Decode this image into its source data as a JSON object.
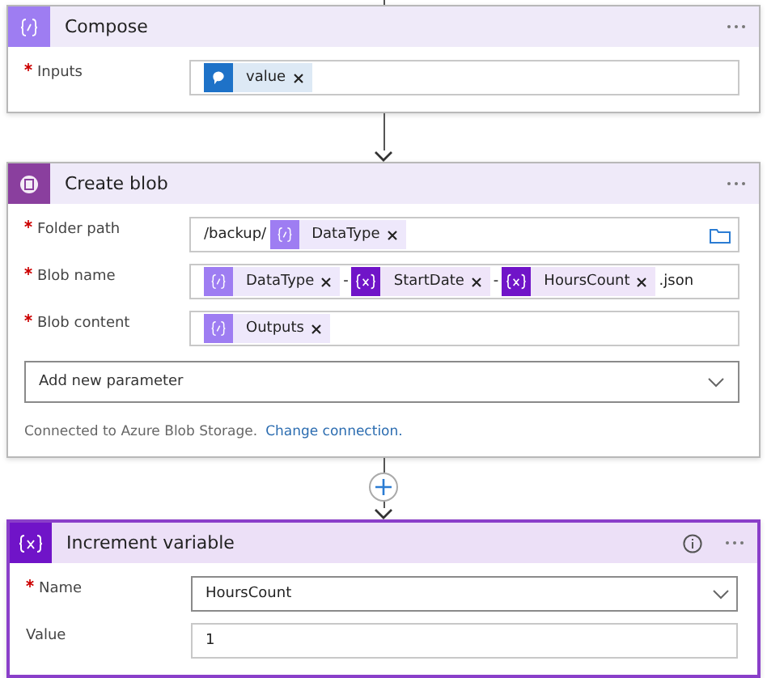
{
  "cards": [
    {
      "kind": "compose",
      "title": "Compose",
      "selected": false,
      "info": false,
      "fields": [
        {
          "label": "Inputs",
          "required": true,
          "kind": "tokens",
          "folder_button": false,
          "parts": [
            {
              "kind": "bot",
              "text": "value"
            }
          ]
        }
      ]
    },
    {
      "kind": "blob",
      "title": "Create blob",
      "selected": false,
      "info": false,
      "fields": [
        {
          "label": "Folder path",
          "required": true,
          "kind": "tokens",
          "folder_button": true,
          "parts": [
            {
              "kind": "text",
              "text": "/backup/"
            },
            {
              "kind": "expression",
              "text": "DataType"
            }
          ]
        },
        {
          "label": "Blob name",
          "required": true,
          "kind": "tokens",
          "folder_button": false,
          "parts": [
            {
              "kind": "expression",
              "text": "DataType"
            },
            {
              "kind": "text",
              "text": "-"
            },
            {
              "kind": "variable",
              "text": "StartDate"
            },
            {
              "kind": "text",
              "text": "-"
            },
            {
              "kind": "variable",
              "text": "HoursCount"
            },
            {
              "kind": "text",
              "text": ".json"
            }
          ]
        },
        {
          "label": "Blob content",
          "required": true,
          "kind": "tokens",
          "folder_button": false,
          "parts": [
            {
              "kind": "expression",
              "text": "Outputs"
            }
          ]
        }
      ],
      "add_parameter": "Add new parameter",
      "connection": {
        "text": "Connected to Azure Blob Storage.",
        "link": "Change connection."
      }
    },
    {
      "kind": "variable",
      "title": "Increment variable",
      "selected": true,
      "info": true,
      "fields": [
        {
          "label": "Name",
          "required": true,
          "kind": "dropdown",
          "value": "HoursCount"
        },
        {
          "label": "Value",
          "required": false,
          "kind": "text",
          "value": "1"
        }
      ]
    }
  ],
  "connectors": [
    {
      "add_button": false
    },
    {
      "add_button": true
    }
  ]
}
